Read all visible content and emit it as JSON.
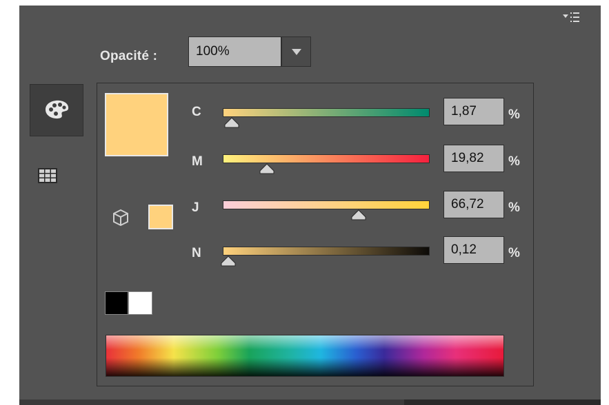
{
  "panel": {
    "menu_icon": "panel-menu-icon",
    "opacity": {
      "label": "Opacité :",
      "value": "100%"
    },
    "tabs": [
      {
        "name": "color",
        "icon": "palette-icon",
        "active": true
      },
      {
        "name": "swatches",
        "icon": "swatches-grid-icon",
        "active": false
      }
    ]
  },
  "colors": {
    "current_fill": "#FFD27D",
    "panel_bg": "#535353"
  },
  "channels": [
    {
      "label": "C",
      "value": "1,87",
      "unit": "%",
      "level": 0.0187,
      "gradient": [
        "#FFD27D",
        "#008A6E"
      ]
    },
    {
      "label": "M",
      "value": "19,82",
      "unit": "%",
      "level": 0.1982,
      "gradient": [
        "#FFF27D",
        "#F5213E"
      ]
    },
    {
      "label": "J",
      "value": "66,72",
      "unit": "%",
      "level": 0.6672,
      "gradient": [
        "#FCCFDA",
        "#FFD33A"
      ]
    },
    {
      "label": "N",
      "value": "0,12",
      "unit": "%",
      "level": 0.0012,
      "gradient": [
        "#FFD27D",
        "#0D0B08"
      ]
    }
  ],
  "quick_swatches": {
    "black": "#000000",
    "white": "#FFFFFF"
  },
  "icons": {
    "gamut": "out-of-gamut-cube-icon"
  }
}
